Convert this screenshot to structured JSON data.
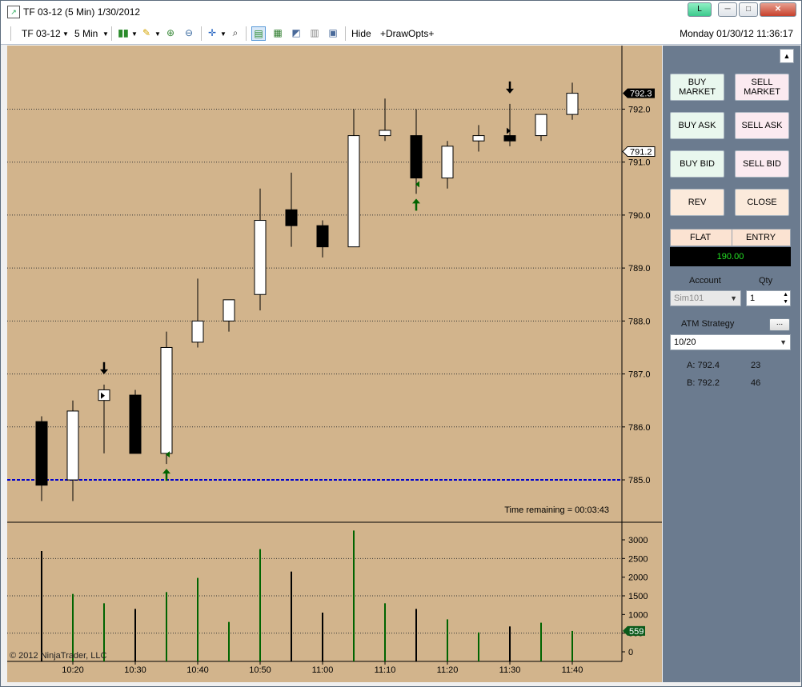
{
  "window": {
    "title": "TF 03-12 (5 Min)  1/30/2012",
    "badge": "L",
    "controls": {
      "minimize": "─",
      "maximize": "□",
      "close": "✕"
    }
  },
  "toolbar": {
    "instrument": "TF 03-12",
    "interval": "5 Min",
    "hide_label": "Hide",
    "drawopts_label": "+DrawOpts+",
    "datetime": "Monday 01/30/12 11:36:17"
  },
  "chart": {
    "price_labels": [
      "792.0",
      "791.0",
      "790.0",
      "789.0",
      "788.0",
      "787.0",
      "786.0",
      "785.0"
    ],
    "last_price_tag": "792.3",
    "bid_tag": "791.2",
    "time_remaining": "Time remaining = 00:03:43",
    "volume_labels": [
      "3000",
      "2500",
      "2000",
      "1500",
      "1000",
      "500",
      "0"
    ],
    "volume_tag": "559",
    "time_labels": [
      "10:20",
      "10:30",
      "10:40",
      "10:50",
      "11:00",
      "11:10",
      "11:20",
      "11:30",
      "11:40"
    ],
    "copyright": "© 2012 NinjaTrader, LLC",
    "colors": {
      "background": "#d2b48c",
      "up_candle": "#ffffff",
      "down_candle": "#000000",
      "up_volume": "#006400",
      "down_volume": "#000000",
      "position_line": "#0000cd"
    }
  },
  "chart_data": {
    "type": "candlestick",
    "instrument": "TF 03-12",
    "interval": "5 Min",
    "x": [
      "10:15",
      "10:20",
      "10:25",
      "10:30",
      "10:35",
      "10:40",
      "10:45",
      "10:50",
      "10:55",
      "11:00",
      "11:05",
      "11:10",
      "11:15",
      "11:20",
      "11:25",
      "11:30",
      "11:35",
      "11:40"
    ],
    "open": [
      786.1,
      785.0,
      786.5,
      786.6,
      785.5,
      787.6,
      788.0,
      788.5,
      790.1,
      789.8,
      789.4,
      791.5,
      791.5,
      790.7,
      791.4,
      791.5,
      791.5,
      791.9
    ],
    "high": [
      786.2,
      786.5,
      786.8,
      786.7,
      787.8,
      788.8,
      788.4,
      790.5,
      790.8,
      789.9,
      792.0,
      792.2,
      792.0,
      791.4,
      791.7,
      792.1,
      791.9,
      792.5
    ],
    "low": [
      784.6,
      784.6,
      785.5,
      785.5,
      785.3,
      787.5,
      787.8,
      788.2,
      789.4,
      789.2,
      789.4,
      791.4,
      790.4,
      790.5,
      791.2,
      791.3,
      791.4,
      791.8
    ],
    "close": [
      784.9,
      786.3,
      786.7,
      785.5,
      787.5,
      788.0,
      788.4,
      789.9,
      789.8,
      789.4,
      791.5,
      791.6,
      790.7,
      791.3,
      791.5,
      791.4,
      791.9,
      792.3
    ],
    "volume": [
      2700,
      1550,
      1300,
      1150,
      1600,
      1980,
      800,
      2750,
      2150,
      1050,
      3250,
      1300,
      1150,
      870,
      520,
      680,
      780,
      559
    ],
    "ylim": [
      784.2,
      793.2
    ],
    "volume_ylim": [
      0,
      3300
    ],
    "current_price": 792.3,
    "bid_price": 791.2,
    "position_price": 785.0,
    "markers": [
      {
        "time": "10:25",
        "type": "sell-arrow"
      },
      {
        "time": "10:35",
        "type": "buy-arrow"
      },
      {
        "time": "11:15",
        "type": "buy-arrow"
      },
      {
        "time": "11:30",
        "type": "sell-arrow"
      }
    ]
  },
  "panel": {
    "buttons": {
      "buy_market": "BUY\nMARKET",
      "sell_market": "SELL\nMARKET",
      "buy_ask": "BUY ASK",
      "sell_ask": "SELL ASK",
      "buy_bid": "BUY BID",
      "sell_bid": "SELL BID",
      "rev": "REV",
      "close": "CLOSE"
    },
    "position": {
      "status": "FLAT",
      "entry_label": "ENTRY",
      "value": "190.00"
    },
    "account_label": "Account",
    "account_value": "Sim101",
    "qty_label": "Qty",
    "qty_value": "1",
    "atm_label": "ATM Strategy",
    "atm_more": "...",
    "atm_value": "10/20",
    "ask": {
      "label": "A: 792.4",
      "size": "23"
    },
    "bid": {
      "label": "B: 792.2",
      "size": "46"
    }
  }
}
